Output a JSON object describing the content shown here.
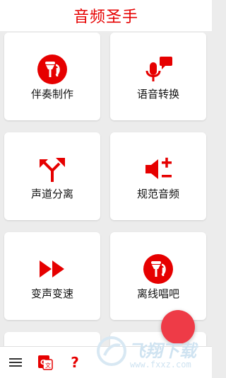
{
  "app": {
    "title": "音频圣手"
  },
  "cards": [
    {
      "label": "伴奏制作",
      "icon": "karaoke-mic-icon"
    },
    {
      "label": "语音转换",
      "icon": "voice-chat-mic-icon"
    },
    {
      "label": "声道分离",
      "icon": "split-arrow-icon"
    },
    {
      "label": "规范音频",
      "icon": "volume-plus-minus-icon"
    },
    {
      "label": "变声变速",
      "icon": "fast-forward-icon"
    },
    {
      "label": "离线唱吧",
      "icon": "karaoke-mic-icon"
    }
  ],
  "bottom_bar": {
    "menu_icon": "menu-icon",
    "translate_icon": "translate-icon",
    "help_icon": "help-icon"
  },
  "watermark": {
    "text": "飞翔下载",
    "url": "www.fxxz.com"
  },
  "colors": {
    "accent": "#e60000",
    "fab": "#ee3b47",
    "background": "#ececec"
  }
}
